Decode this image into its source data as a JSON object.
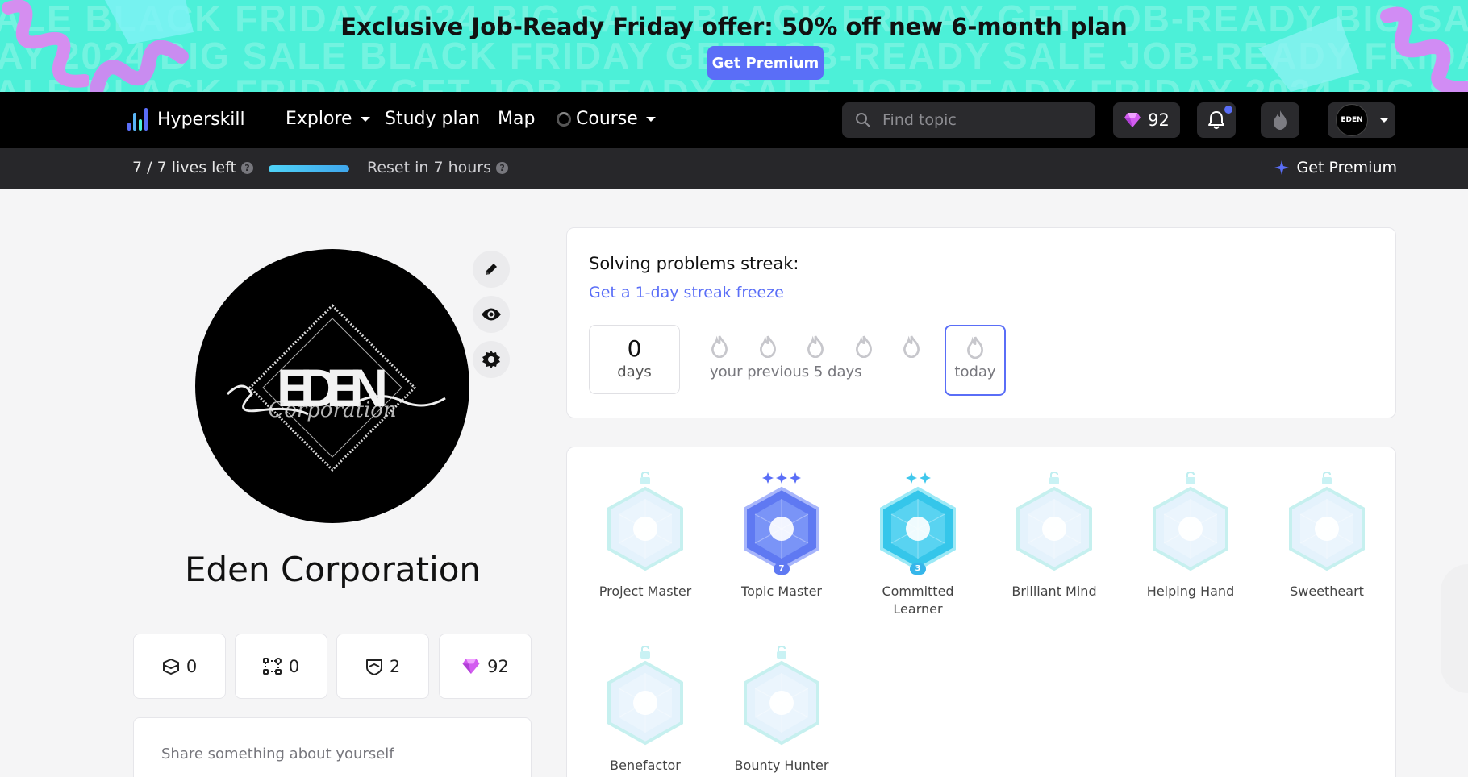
{
  "promo": {
    "title": "Exclusive Job-Ready Friday offer: 50% off new 6-month plan",
    "button": "Get Premium",
    "bg_lines": [
      "SALE  BLACK FRIDAY 2024  BIG SALE  BLACK FRIDAY GET JOB-READY  BIG SALE  JOB-READY",
      "FRIDAY 2024  BIG SALE  BLACK FRIDAY  GET JOB-READY  SALE  JOB-READY  FRIDAY",
      "SALE  BLACK FRIDAY  GET JOB-READY  SALE  JOB-READY  FRIDAY 2024  BIG SALE"
    ],
    "colors": {
      "background": "#4cf0d8",
      "button": "#5a6ef7"
    }
  },
  "nav": {
    "brand": "Hyperskill",
    "items": [
      {
        "label": "Explore",
        "has_caret": true
      },
      {
        "label": "Study plan",
        "has_caret": false
      },
      {
        "label": "Map",
        "has_caret": false
      },
      {
        "label": "Course",
        "has_caret": true
      }
    ],
    "search_placeholder": "Find topic",
    "gems": "92",
    "icons": [
      "search-icon",
      "gem-icon",
      "bell-icon",
      "flame-icon",
      "chevron-down-icon"
    ]
  },
  "subbar": {
    "lives": "7 / 7 lives left",
    "lives_fraction": 1.0,
    "reset": "Reset in 7 hours",
    "get_premium": "Get Premium"
  },
  "profile": {
    "name": "Eden Corporation",
    "avatar_text": "EDEN",
    "avatar_script": "Corporation",
    "stats": [
      {
        "icon": "projects-icon",
        "value": "0"
      },
      {
        "icon": "topics-icon",
        "value": "0"
      },
      {
        "icon": "badges-icon",
        "value": "2"
      },
      {
        "icon": "gem-icon",
        "value": "92"
      }
    ],
    "about_placeholder": "Share something about yourself"
  },
  "streak": {
    "title": "Solving problems streak:",
    "freeze_link": "Get a 1-day streak freeze",
    "days_value": "0",
    "days_label": "days",
    "previous_label": "your previous 5 days",
    "today_label": "today"
  },
  "badges": [
    {
      "name": "Project Master",
      "locked": true,
      "level": null,
      "stars": 0
    },
    {
      "name": "Topic Master",
      "locked": false,
      "level": "7",
      "stars": 3
    },
    {
      "name": "Committed Learner",
      "locked": false,
      "level": "3",
      "stars": 2
    },
    {
      "name": "Brilliant Mind",
      "locked": true,
      "level": null,
      "stars": 0
    },
    {
      "name": "Helping Hand",
      "locked": true,
      "level": null,
      "stars": 0
    },
    {
      "name": "Sweetheart",
      "locked": true,
      "level": null,
      "stars": 0
    },
    {
      "name": "Benefactor",
      "locked": true,
      "level": null,
      "stars": 0
    },
    {
      "name": "Bounty Hunter",
      "locked": true,
      "level": null,
      "stars": 0
    }
  ]
}
